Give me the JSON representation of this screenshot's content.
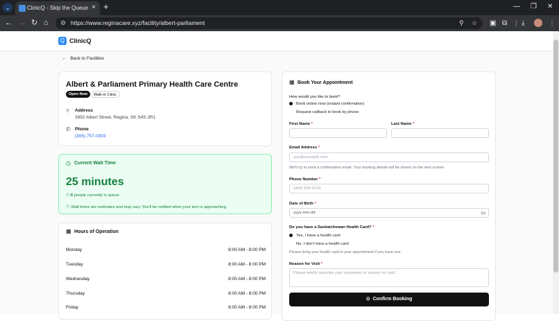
{
  "browser": {
    "tab_title": "ClinicQ - Skip the Queue",
    "url": "https://www.reginacare.xyz/facility/albert-parliament"
  },
  "app": {
    "brand": "ClinicQ",
    "back_label": "Back to Facilities"
  },
  "facility": {
    "name": "Albert & Parliament Primary Health Care Centre",
    "badges": [
      "Open Now",
      "Walk-in Clinic"
    ],
    "address_label": "Address",
    "address": "3992 Albert Street, Regina, SK S4S 3R1",
    "phone_label": "Phone",
    "phone": "(306) 757-0303"
  },
  "wait": {
    "title": "Current Wait Time",
    "value": "25 minutes",
    "queue_count": "6",
    "queue_text": "people currently in queue",
    "note": "Wait times are estimates and may vary. You'll be notified when your turn is approaching."
  },
  "hours": {
    "title": "Hours of Operation",
    "rows": [
      {
        "day": "Monday",
        "time": "8:00 AM - 8:00 PM"
      },
      {
        "day": "Tuesday",
        "time": "8:00 AM - 8:00 PM"
      },
      {
        "day": "Wednesday",
        "time": "8:00 AM - 8:00 PM"
      },
      {
        "day": "Thursday",
        "time": "8:00 AM - 8:00 PM"
      },
      {
        "day": "Friday",
        "time": "8:00 AM - 8:00 PM"
      }
    ]
  },
  "booking": {
    "title": "Book Your Appointment",
    "method_question": "How would you like to book?",
    "method_options": [
      "Book online now (instant confirmation)",
      "Request callback to book by phone"
    ],
    "first_name_label": "First Name",
    "last_name_label": "Last Name",
    "email_label": "Email Address",
    "email_placeholder": "you@example.com",
    "email_help": "We'll try to send a confirmation email. Your booking details will be shown on the next screen.",
    "phone_label": "Phone Number",
    "phone_placeholder": "(306) 555-0123",
    "dob_label": "Date of Birth",
    "dob_placeholder": "yyyy-mm-dd",
    "card_question": "Do you have a Saskatchewan Health Card?",
    "card_options": [
      "Yes, I have a health card",
      "No, I don't have a health card"
    ],
    "card_help": "Please bring your health card to your appointment if you have one",
    "reason_label": "Reason for Visit",
    "reason_placeholder": "Please briefly describe your symptoms or reason for visit...",
    "submit_label": "Confirm Booking",
    "required_mark": "*"
  },
  "colors": {
    "accent": "#2d8cf0",
    "wait_bg": "#ecfdf3",
    "wait_green": "#15803d",
    "button": "#111111"
  }
}
